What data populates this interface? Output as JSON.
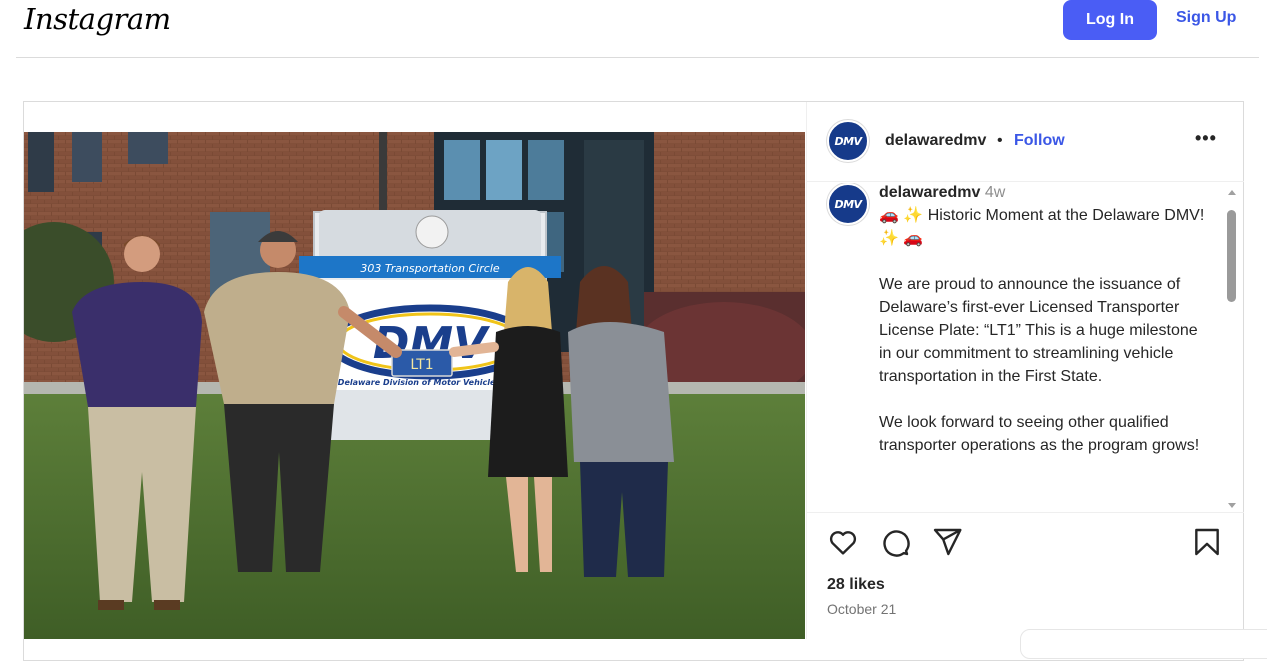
{
  "header": {
    "logo_text": "Instagram",
    "login_label": "Log In",
    "signup_label": "Sign Up"
  },
  "post": {
    "username": "delawaredmv",
    "separator": "•",
    "follow_label": "Follow",
    "more_label": "•••",
    "avatar_text": "DMV",
    "photo": {
      "sign_street": "303 Transportation Circle",
      "sign_org": "Delaware Division of Motor Vehicles",
      "sign_logo": "DMV",
      "plate_text": "LT1"
    },
    "caption": {
      "username": "delawaredmv",
      "time": "4w",
      "paragraphs": [
        "🚗 ✨ Historic Moment at the Delaware DMV! ✨ 🚗",
        "We are proud to announce the issuance of Delaware’s first-ever Licensed Transporter License Plate: “LT1” This is a huge milestone in our commitment to streamlining vehicle transportation in the First State.",
        "We look forward to seeing other qualified transporter operations as the program grows!"
      ]
    },
    "icons": {
      "like": "heart-icon",
      "comment": "comment-icon",
      "share": "share-icon",
      "save": "bookmark-icon"
    },
    "likes_text": "28 likes",
    "date_text": "October 21"
  },
  "colors": {
    "primary_button": "#4a5df5",
    "link": "#3b57e6",
    "border": "#dbdbdb",
    "avatar_bg": "#163a8a"
  }
}
